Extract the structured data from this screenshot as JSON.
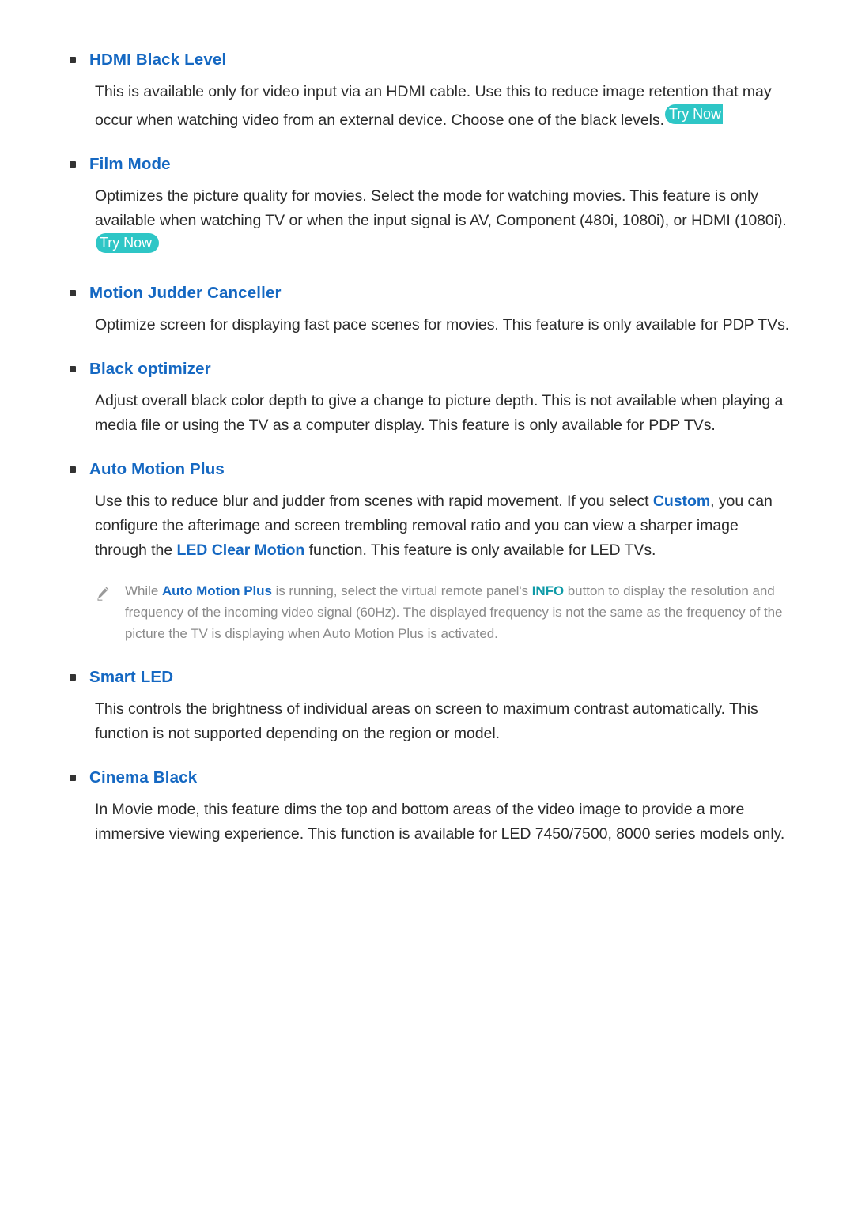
{
  "document": {
    "type": "e-manual-page",
    "theme": {
      "heading_color": "#1568c2",
      "body_color": "#2b2b2b",
      "note_color": "#8a8a8a",
      "accent_teal": "#2ec6c6",
      "keyword_teal": "#0e9aa7",
      "background": "#ffffff"
    }
  },
  "badges": {
    "try_now": "Try Now"
  },
  "icons": {
    "note_pencil": "pencil-icon",
    "bullet": "square-bullet"
  },
  "sections": [
    {
      "id": "hdmi-black-level",
      "heading": "HDMI Black Level",
      "body_part_1": "This is available only for video input via an HDMI cable. Use this to reduce image retention that may occur when watching video from an external device. Choose one of the black levels.",
      "has_try_now": true
    },
    {
      "id": "film-mode",
      "heading": "Film Mode",
      "body_part_1": "Optimizes the picture quality for movies. Select the mode for watching movies. This feature is only available when watching TV or when the input signal is AV, Component (480i, 1080i), or HDMI (1080i).",
      "has_try_now": true
    },
    {
      "id": "motion-judder-canceller",
      "heading": "Motion Judder Canceller",
      "body_part_1": "Optimize screen for displaying fast pace scenes for movies. This feature is only available for PDP TVs.",
      "has_try_now": false
    },
    {
      "id": "black-optimizer",
      "heading": "Black optimizer",
      "body_part_1": "Adjust overall black color depth to give a change to picture depth. This is not available when playing a media file or using the TV as a computer display. This feature is only available for PDP TVs.",
      "has_try_now": false
    },
    {
      "id": "auto-motion-plus",
      "heading": "Auto Motion Plus",
      "body_segments": [
        {
          "text": "Use this to reduce blur and judder from scenes with rapid movement. If you select ",
          "style": "plain"
        },
        {
          "text": "Custom",
          "style": "keyword-blue"
        },
        {
          "text": ", you can configure the afterimage and screen trembling removal ratio and you can view a sharper image through the ",
          "style": "plain"
        },
        {
          "text": "LED Clear Motion",
          "style": "keyword-blue"
        },
        {
          "text": " function. This feature is only available for LED TVs.",
          "style": "plain"
        }
      ],
      "note": {
        "segments": [
          {
            "text": "While ",
            "style": "plain"
          },
          {
            "text": "Auto Motion Plus",
            "style": "keyword-blue"
          },
          {
            "text": " is running, select the virtual remote panel's ",
            "style": "plain"
          },
          {
            "text": "INFO",
            "style": "keyword-teal"
          },
          {
            "text": " button to display the resolution and frequency of the incoming video signal (60Hz). The displayed frequency is not the same as the frequency of the picture the TV is displaying when Auto Motion Plus is activated.",
            "style": "plain"
          }
        ]
      }
    },
    {
      "id": "smart-led",
      "heading": "Smart LED",
      "body_part_1": "This controls the brightness of individual areas on screen to maximum contrast automatically. This function is not supported depending on the region or model.",
      "has_try_now": false
    },
    {
      "id": "cinema-black",
      "heading": "Cinema Black",
      "body_part_1": "In Movie mode, this feature dims the top and bottom areas of the video image to provide a more immersive viewing experience. This function is available for LED 7450/7500, 8000 series models only.",
      "has_try_now": false
    }
  ]
}
